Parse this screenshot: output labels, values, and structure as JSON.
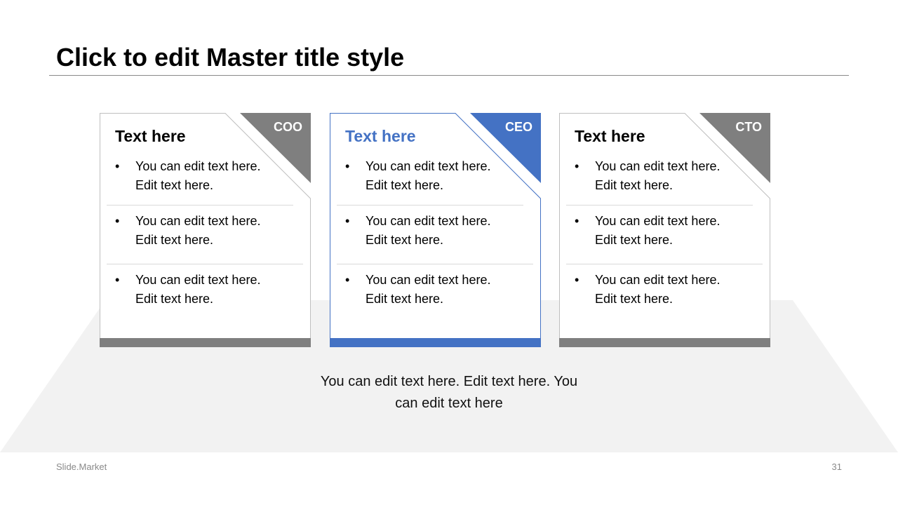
{
  "slide": {
    "title": "Click to edit Master title style",
    "center_text": "You can edit text here. Edit text here. You can edit text here",
    "footer_brand": "Slide.Market",
    "page_number": "31"
  },
  "colors": {
    "gray_accent": "#7f7f7f",
    "blue_accent": "#4472c4",
    "platform": "#f2f2f2",
    "card_border": "#bfbfbf"
  },
  "cards": [
    {
      "role": "COO",
      "heading": "Text here",
      "accent": "#7f7f7f",
      "heading_color": "#000000",
      "bullets": [
        "You can edit text here. Edit text here.",
        "You can edit text here. Edit text here.",
        "You can edit text here. Edit text here."
      ]
    },
    {
      "role": "CEO",
      "heading": "Text here",
      "accent": "#4472c4",
      "heading_color": "#4472c4",
      "bullets": [
        "You can edit text here. Edit text here.",
        "You can edit text here. Edit text here.",
        "You can edit text here. Edit text here."
      ]
    },
    {
      "role": "CTO",
      "heading": "Text here",
      "accent": "#7f7f7f",
      "heading_color": "#000000",
      "bullets": [
        "You can edit text here. Edit text here.",
        "You can edit text here. Edit text here.",
        "You can edit text here. Edit text here."
      ]
    }
  ]
}
